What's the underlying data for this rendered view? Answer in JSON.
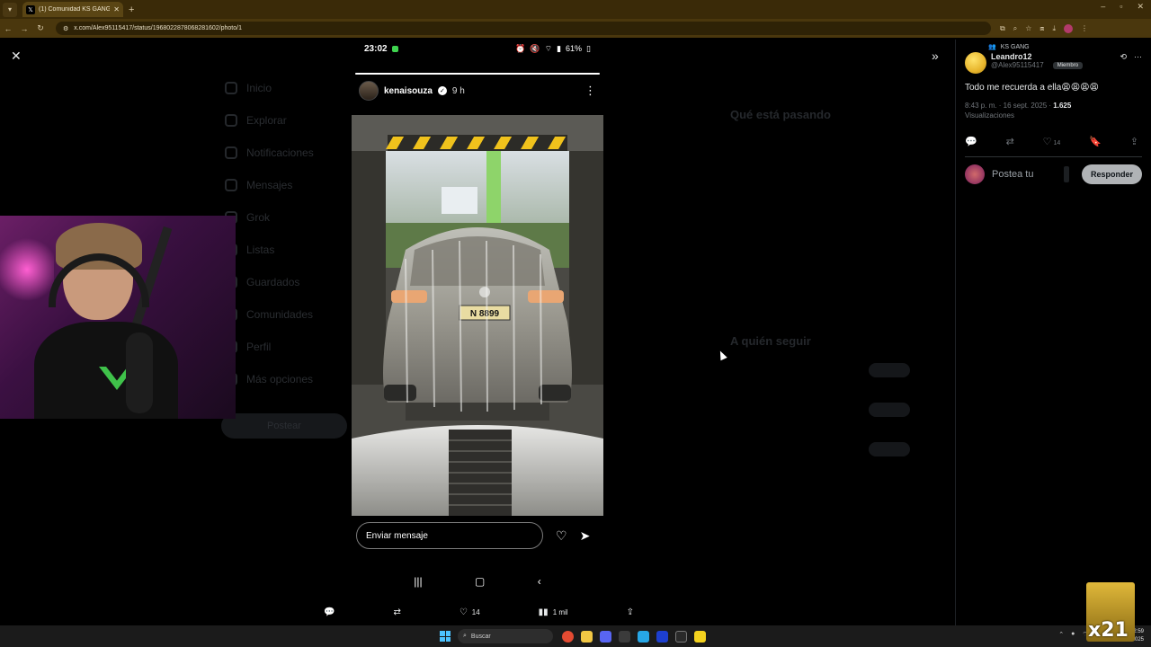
{
  "browser": {
    "tab_title": "(1) Comunidad KS GANG / X",
    "url": "x.com/Alex95115417/status/1968022878068281602/photo/1"
  },
  "backdrop": {
    "sidebar": [
      "Inicio",
      "Explorar",
      "Notificaciones",
      "Mensajes",
      "Grok",
      "Listas",
      "Guardados",
      "Comunidades",
      "Perfil",
      "Más opciones"
    ],
    "post_label": "Postear",
    "trending_title": "Qué está pasando",
    "follow_title": "A quién seguir"
  },
  "story": {
    "status_time": "23:02",
    "battery": "61%",
    "username": "kenaisouza",
    "time_ago": "9 h",
    "plate": "N 8899",
    "message_placeholder": "Enviar mensaje",
    "progress": 1.0
  },
  "tweet_actions": {
    "likes": "14",
    "views": "1 mil"
  },
  "panel": {
    "community": "KS GANG",
    "author_name": "Leandro12",
    "author_handle": "@Alex95115417",
    "member_badge": "Miembro",
    "text": "Todo me recuerda a ella😩😩😩😩",
    "timestamp": "8:43 p. m. · 16 sept. 2025 ·",
    "views_count": "1.625",
    "views_label": "Visualizaciones",
    "like_count": "14",
    "reply_placeholder": "Postea tu",
    "reply_button": "Responder"
  },
  "taskbar": {
    "search": "Buscar",
    "time": "22:59",
    "date": "16/09/2025"
  },
  "overlay": {
    "badge": "x21"
  }
}
